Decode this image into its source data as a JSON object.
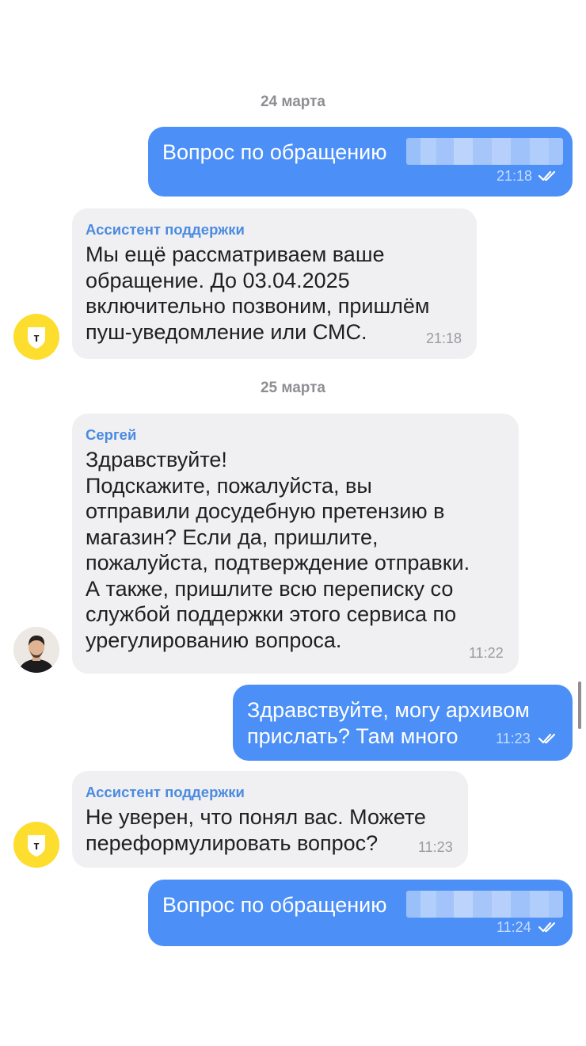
{
  "dates": [
    "24 марта",
    "25 марта"
  ],
  "messages": [
    {
      "direction": "out",
      "text": "Вопрос по обращению",
      "redacted_ticket_number": true,
      "time": "21:18",
      "status": "read"
    },
    {
      "direction": "in",
      "sender": "Ассистент поддержки",
      "text": "Мы ещё рассматриваем ваше\nобращение. До 03.04.2025\nвключительно позвоним, пришлём\nпуш-уведомление или СМС.",
      "time": "21:18"
    },
    {
      "direction": "in",
      "sender": "Сергей",
      "text": "Здравствуйте!\nПодскажите, пожалуйста, вы\nотправили досудебную претензию в\nмагазин? Если да, пришлите,\nпожалуйста, подтверждение отправки.\nА также, пришлите всю переписку со\nслужбой поддержки этого сервиса по\nурегулированию вопроса.",
      "time": "11:22"
    },
    {
      "direction": "out",
      "text": "Здравствуйте, могу архивом\nприслать? Там много",
      "time": "11:23",
      "status": "read"
    },
    {
      "direction": "in",
      "sender": "Ассистент поддержки",
      "text": "Не уверен, что понял вас. Можете\nпереформулировать вопрос?",
      "time": "11:23"
    },
    {
      "direction": "out",
      "text": "Вопрос по обращению",
      "redacted_ticket_number": true,
      "time": "11:24",
      "status": "read"
    }
  ],
  "avatars": {
    "assistant": {
      "letter": "т",
      "color": "#fddd2d",
      "icon": "bank-shield-logo"
    },
    "operator": {
      "icon": "user-photo"
    }
  },
  "colors": {
    "outgoing_bubble": "#4b8ff7",
    "incoming_bubble": "#f0f0f2",
    "sender_name": "#4b8be0",
    "date": "#8e8e93"
  }
}
